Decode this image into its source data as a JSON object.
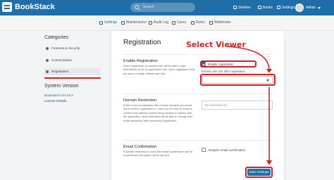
{
  "app": {
    "name": "BookStack"
  },
  "header": {
    "search_placeholder": "Search",
    "nav": [
      "Shelves",
      "Books",
      "Settings"
    ],
    "user_name": "Admin"
  },
  "tabs": [
    "Settings",
    "Maintenance",
    "Audit Log",
    "Users",
    "Roles",
    "Webhooks"
  ],
  "sidebar": {
    "categories_title": "Categories",
    "items": [
      "Features & Security",
      "Customization",
      "Registration"
    ],
    "active_item": "Registration",
    "system_version_title": "System Version",
    "version": "BookStack v24.05.4",
    "license": "License Details"
  },
  "main": {
    "title": "Registration",
    "enable_registration": {
      "title": "Enable Registration",
      "description": "When registration is enabled user will be able to sign themselves up as an application user. Upon registration they are given a single, default user role.",
      "checkbox_label": "Enable registration",
      "checked": true,
      "role_label": "Default user role after registration",
      "role_value": ""
    },
    "domain_restriction": {
      "title": "Domain Restriction",
      "description": "Enter a comma separated list of email domains you would like to restrict registration to. Users will be sent an email to confirm their address before being allowed to interact with the application. Note that users will be able to change their email addresses after successful registration.",
      "placeholder": "No restriction set"
    },
    "email_confirmation": {
      "title": "Email Confirmation",
      "description": "If domain restriction is used then email confirmation will be required and this option will be ignored.",
      "checkbox_label": "Require email confirmation",
      "checked": false
    },
    "save_label": "Save Settings"
  },
  "annotation": {
    "text": "Select Viewer",
    "color": "#d0202a"
  },
  "colors": {
    "brand": "#206ea7",
    "annotation": "#d0202a"
  }
}
